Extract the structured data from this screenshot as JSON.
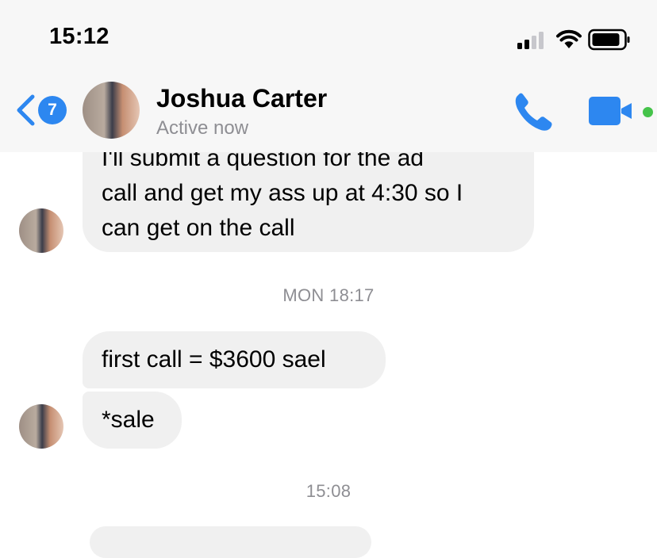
{
  "status_bar": {
    "time": "15:12"
  },
  "header": {
    "back_badge": "7",
    "contact_name": "Joshua Carter",
    "contact_status": "Active now"
  },
  "colors": {
    "accent": "#2d87f0",
    "active_dot": "#45c34a",
    "bubble_bg": "#f0f0f0",
    "muted_text": "#8e8e93"
  },
  "icons": [
    "back-chevron-icon",
    "phone-icon",
    "video-camera-icon",
    "signal-icon",
    "wifi-icon",
    "battery-icon"
  ],
  "messages": [
    {
      "lines": [
        "I'll submit a question for the ad",
        "call and get my ass up at 4:30 so I",
        "can get on the call"
      ]
    },
    {
      "timestamp": "MON 18:17"
    },
    {
      "text": "first call = $3600 sael"
    },
    {
      "text": "*sale"
    },
    {
      "timestamp": "15:08"
    }
  ]
}
